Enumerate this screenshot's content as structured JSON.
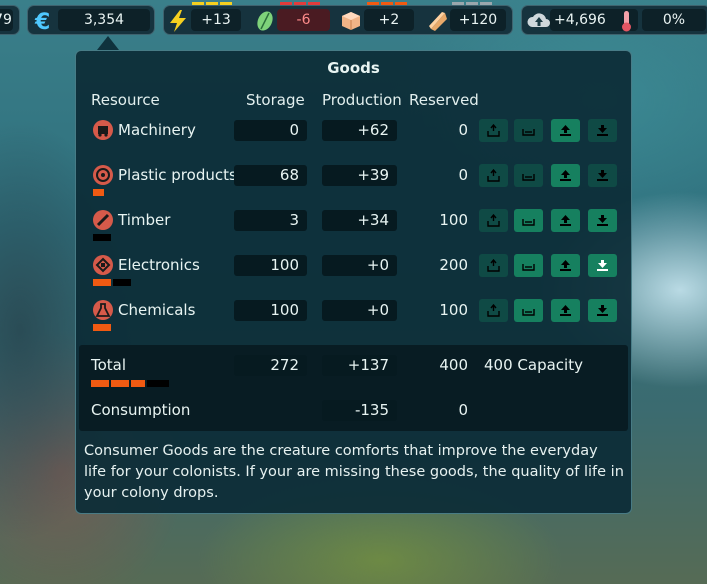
{
  "topbar": {
    "partial_value": "79",
    "euro": {
      "icon": "euro-icon",
      "value": "3,354"
    },
    "energy": {
      "icon": "lightning-icon",
      "value": "+13"
    },
    "food": {
      "icon": "leaf-icon",
      "value": "-6"
    },
    "goods": {
      "icon": "box-icon",
      "value": "+2"
    },
    "materials": {
      "icon": "ingot-icon",
      "value": "+120"
    },
    "hub": {
      "icon": "cloud-up-icon",
      "value": "+4,696"
    },
    "temperature": {
      "icon": "thermometer-icon",
      "value": "0%"
    }
  },
  "panel": {
    "title": "Goods",
    "headers": {
      "resource": "Resource",
      "storage": "Storage",
      "production": "Production",
      "reserved": "Reserved"
    },
    "rows": [
      {
        "name": "Machinery",
        "icon": "machinery-icon",
        "storage": "0",
        "production": "+62",
        "reserved": "0"
      },
      {
        "name": "Plastic products",
        "icon": "plastic-icon",
        "storage": "68",
        "production": "+39",
        "reserved": "0"
      },
      {
        "name": "Timber",
        "icon": "timber-icon",
        "storage": "3",
        "production": "+34",
        "reserved": "100"
      },
      {
        "name": "Electronics",
        "icon": "electronics-icon",
        "storage": "100",
        "production": "+0",
        "reserved": "200"
      },
      {
        "name": "Chemicals",
        "icon": "chemicals-icon",
        "storage": "100",
        "production": "+0",
        "reserved": "100"
      }
    ],
    "total": {
      "label": "Total",
      "storage": "272",
      "production": "+137",
      "reserved": "400",
      "capacity": "400 Capacity"
    },
    "consumption": {
      "label": "Consumption",
      "production": "-135",
      "reserved": "0"
    },
    "description": "Consumer Goods are the creature comforts that improve the everyday life for your colonists. If your are missing these goods, the quality of life in your colony drops."
  },
  "colors": {
    "accent": "#16805f",
    "panel_bg": "#0c2c37",
    "bar_orange": "#f05a12",
    "negative": "#ff8b8b"
  }
}
